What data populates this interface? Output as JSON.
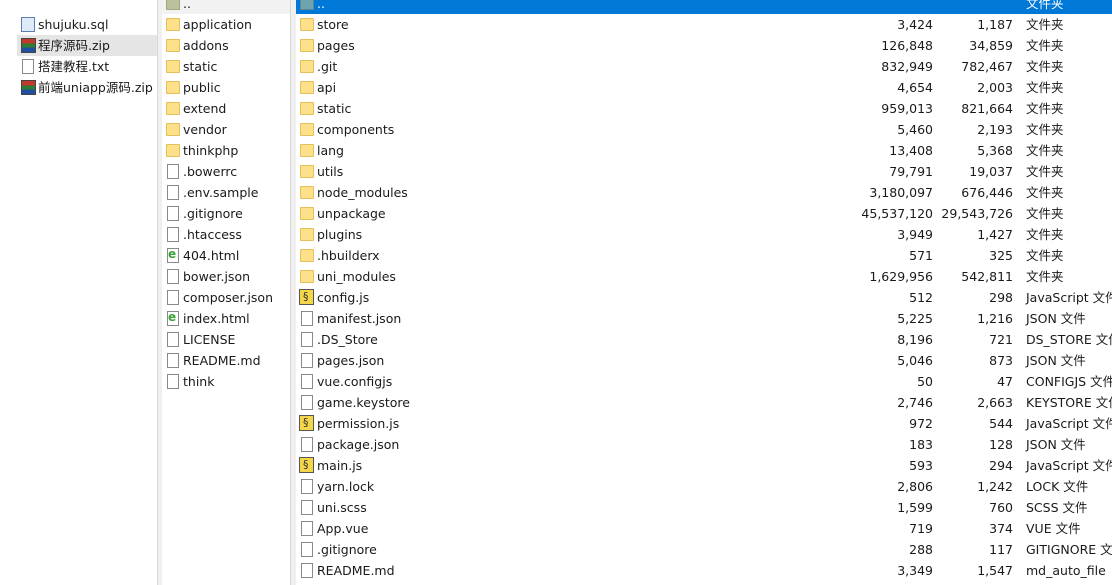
{
  "left_panel": {
    "items": [
      {
        "name": "shujuku.sql",
        "icon": "sql"
      },
      {
        "name": "程序源码.zip",
        "icon": "zip",
        "selected": true
      },
      {
        "name": "搭建教程.txt",
        "icon": "file"
      },
      {
        "name": "前端uniapp源码.zip",
        "icon": "zip"
      }
    ]
  },
  "middle_panel": {
    "items": [
      {
        "name": "..",
        "icon": "up"
      },
      {
        "name": "application",
        "icon": "folder"
      },
      {
        "name": "addons",
        "icon": "folder"
      },
      {
        "name": "static",
        "icon": "folder"
      },
      {
        "name": "public",
        "icon": "folder"
      },
      {
        "name": "extend",
        "icon": "folder"
      },
      {
        "name": "vendor",
        "icon": "folder"
      },
      {
        "name": "thinkphp",
        "icon": "folder"
      },
      {
        "name": ".bowerrc",
        "icon": "file"
      },
      {
        "name": ".env.sample",
        "icon": "file"
      },
      {
        "name": ".gitignore",
        "icon": "file"
      },
      {
        "name": ".htaccess",
        "icon": "file"
      },
      {
        "name": "404.html",
        "icon": "html"
      },
      {
        "name": "bower.json",
        "icon": "file"
      },
      {
        "name": "composer.json",
        "icon": "file"
      },
      {
        "name": "index.html",
        "icon": "html"
      },
      {
        "name": "LICENSE",
        "icon": "file"
      },
      {
        "name": "README.md",
        "icon": "file"
      },
      {
        "name": "think",
        "icon": "file"
      }
    ]
  },
  "right_panel": {
    "items": [
      {
        "name": "..",
        "size": "",
        "packed": "",
        "type": "文件夹",
        "icon": "upblue"
      },
      {
        "name": "store",
        "size": "3,424",
        "packed": "1,187",
        "type": "文件夹",
        "icon": "folder"
      },
      {
        "name": "pages",
        "size": "126,848",
        "packed": "34,859",
        "type": "文件夹",
        "icon": "folder"
      },
      {
        "name": ".git",
        "size": "832,949",
        "packed": "782,467",
        "type": "文件夹",
        "icon": "folder"
      },
      {
        "name": "api",
        "size": "4,654",
        "packed": "2,003",
        "type": "文件夹",
        "icon": "folder"
      },
      {
        "name": "static",
        "size": "959,013",
        "packed": "821,664",
        "type": "文件夹",
        "icon": "folder"
      },
      {
        "name": "components",
        "size": "5,460",
        "packed": "2,193",
        "type": "文件夹",
        "icon": "folder"
      },
      {
        "name": "lang",
        "size": "13,408",
        "packed": "5,368",
        "type": "文件夹",
        "icon": "folder"
      },
      {
        "name": "utils",
        "size": "79,791",
        "packed": "19,037",
        "type": "文件夹",
        "icon": "folder"
      },
      {
        "name": "node_modules",
        "size": "3,180,097",
        "packed": "676,446",
        "type": "文件夹",
        "icon": "folder"
      },
      {
        "name": "unpackage",
        "size": "45,537,120",
        "packed": "29,543,726",
        "type": "文件夹",
        "icon": "folder"
      },
      {
        "name": "plugins",
        "size": "3,949",
        "packed": "1,427",
        "type": "文件夹",
        "icon": "folder"
      },
      {
        "name": ".hbuilderx",
        "size": "571",
        "packed": "325",
        "type": "文件夹",
        "icon": "folder"
      },
      {
        "name": "uni_modules",
        "size": "1,629,956",
        "packed": "542,811",
        "type": "文件夹",
        "icon": "folder"
      },
      {
        "name": "config.js",
        "size": "512",
        "packed": "298",
        "type": "JavaScript 文件",
        "icon": "js"
      },
      {
        "name": "manifest.json",
        "size": "5,225",
        "packed": "1,216",
        "type": "JSON 文件",
        "icon": "file"
      },
      {
        "name": ".DS_Store",
        "size": "8,196",
        "packed": "721",
        "type": "DS_STORE 文件",
        "icon": "file"
      },
      {
        "name": "pages.json",
        "size": "5,046",
        "packed": "873",
        "type": "JSON 文件",
        "icon": "file"
      },
      {
        "name": "vue.configjs",
        "size": "50",
        "packed": "47",
        "type": "CONFIGJS 文件",
        "icon": "file"
      },
      {
        "name": "game.keystore",
        "size": "2,746",
        "packed": "2,663",
        "type": "KEYSTORE 文件",
        "icon": "file"
      },
      {
        "name": "permission.js",
        "size": "972",
        "packed": "544",
        "type": "JavaScript 文件",
        "icon": "js"
      },
      {
        "name": "package.json",
        "size": "183",
        "packed": "128",
        "type": "JSON 文件",
        "icon": "file"
      },
      {
        "name": "main.js",
        "size": "593",
        "packed": "294",
        "type": "JavaScript 文件",
        "icon": "js"
      },
      {
        "name": "yarn.lock",
        "size": "2,806",
        "packed": "1,242",
        "type": "LOCK 文件",
        "icon": "file"
      },
      {
        "name": "uni.scss",
        "size": "1,599",
        "packed": "760",
        "type": "SCSS 文件",
        "icon": "file"
      },
      {
        "name": "App.vue",
        "size": "719",
        "packed": "374",
        "type": "VUE 文件",
        "icon": "file"
      },
      {
        "name": ".gitignore",
        "size": "288",
        "packed": "117",
        "type": "GITIGNORE 文件",
        "icon": "file"
      },
      {
        "name": "README.md",
        "size": "3,349",
        "packed": "1,547",
        "type": "md_auto_file",
        "icon": "file"
      }
    ]
  }
}
